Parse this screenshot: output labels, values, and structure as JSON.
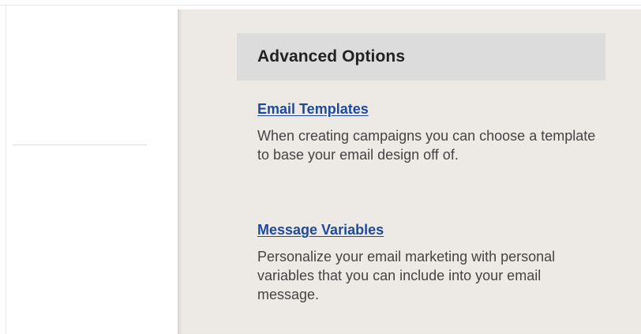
{
  "advanced_options": {
    "title": "Advanced Options",
    "options": [
      {
        "link": "Email Templates",
        "description": "When creating campaigns you can choose a template to base your email design off of."
      },
      {
        "link": "Message Variables",
        "description": "Personalize your email marketing with personal variables that you can include into your email message."
      }
    ]
  },
  "colors": {
    "link": "#1f4a9b",
    "sidebar_bg": "#edeae6",
    "header_bg": "#dcdcdc",
    "text": "#444444"
  }
}
